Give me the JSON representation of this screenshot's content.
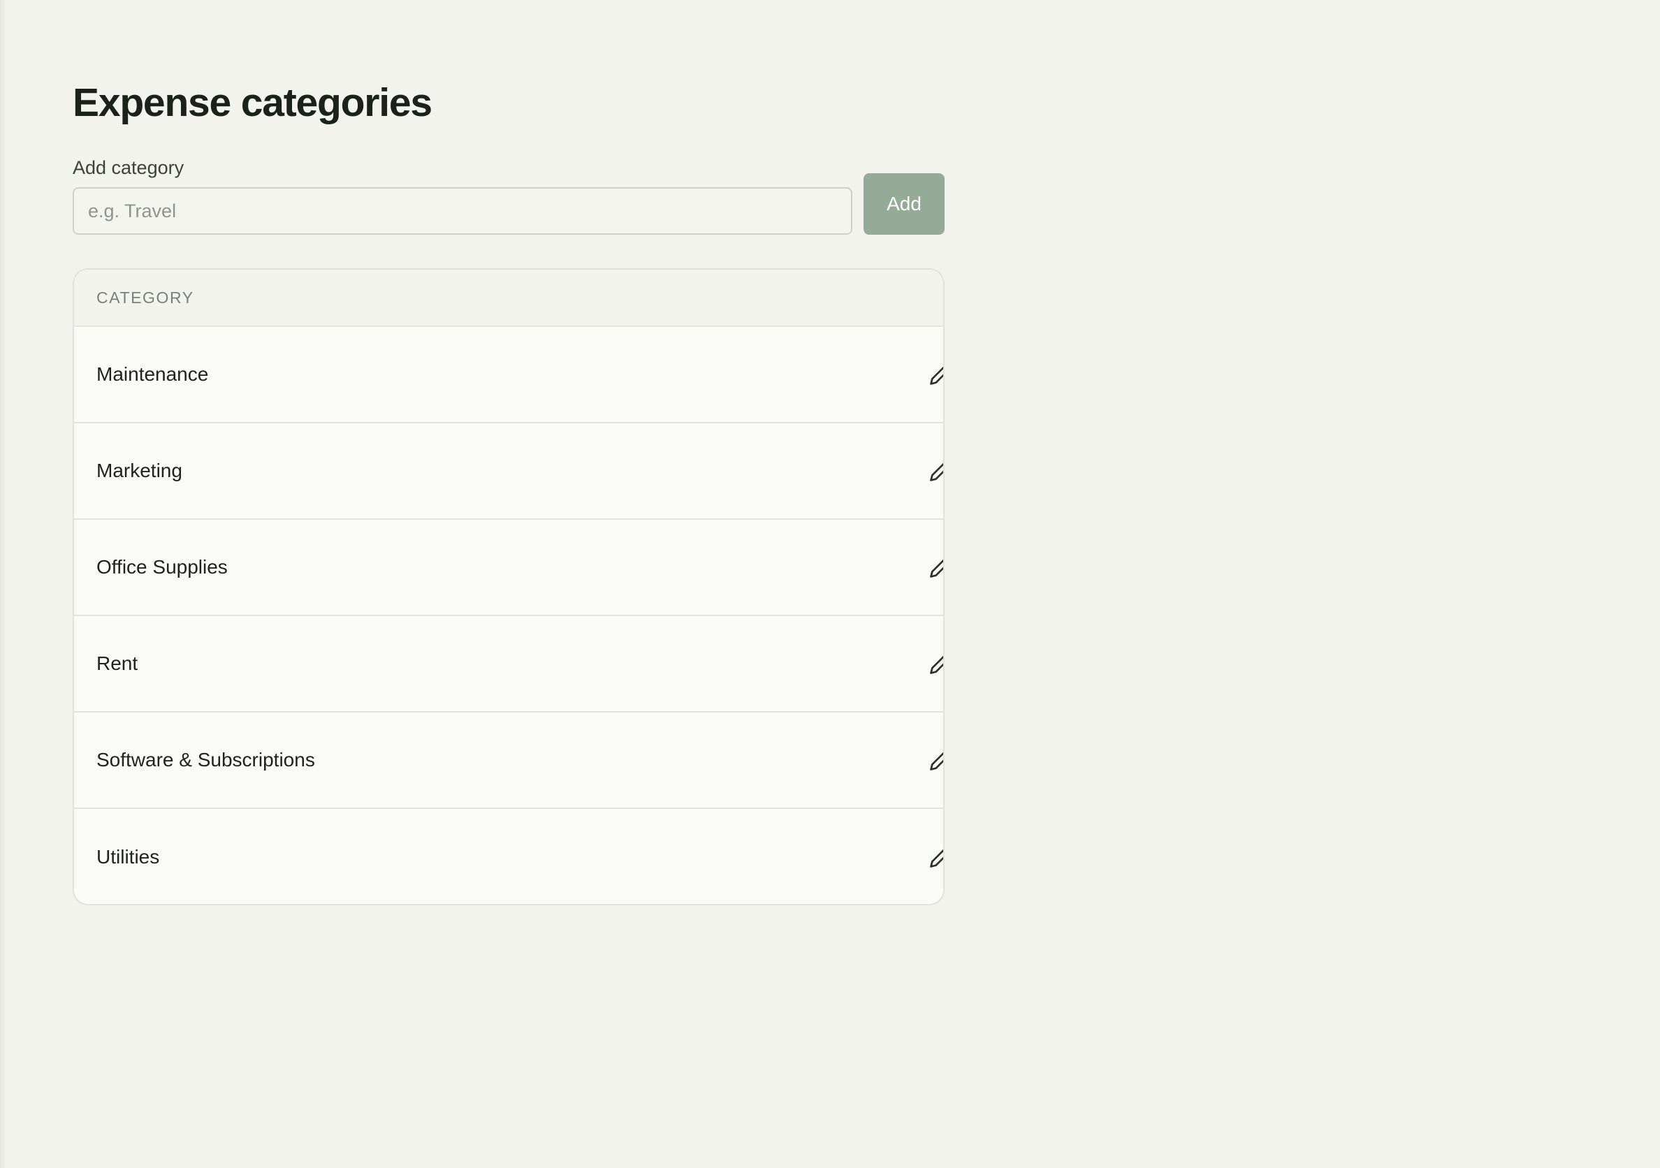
{
  "page": {
    "title": "Expense categories"
  },
  "add_form": {
    "label": "Add category",
    "placeholder": "e.g. Travel",
    "value": "",
    "button_label": "Add"
  },
  "table": {
    "column_header": "CATEGORY",
    "rows": [
      {
        "label": "Maintenance",
        "action_icon": "pencil-icon"
      },
      {
        "label": "Marketing",
        "action_icon": "pencil-icon"
      },
      {
        "label": "Office Supplies",
        "action_icon": "pencil-icon"
      },
      {
        "label": "Rent",
        "action_icon": "pencil-icon"
      },
      {
        "label": "Software & Subscriptions",
        "action_icon": "pencil-icon"
      },
      {
        "label": "Utilities",
        "action_icon": "pencil-icon"
      }
    ]
  },
  "colors": {
    "background": "#f3f3ee",
    "accent_button": "#94ab98",
    "text_primary": "#1d231d",
    "text_muted": "#7a8079"
  }
}
